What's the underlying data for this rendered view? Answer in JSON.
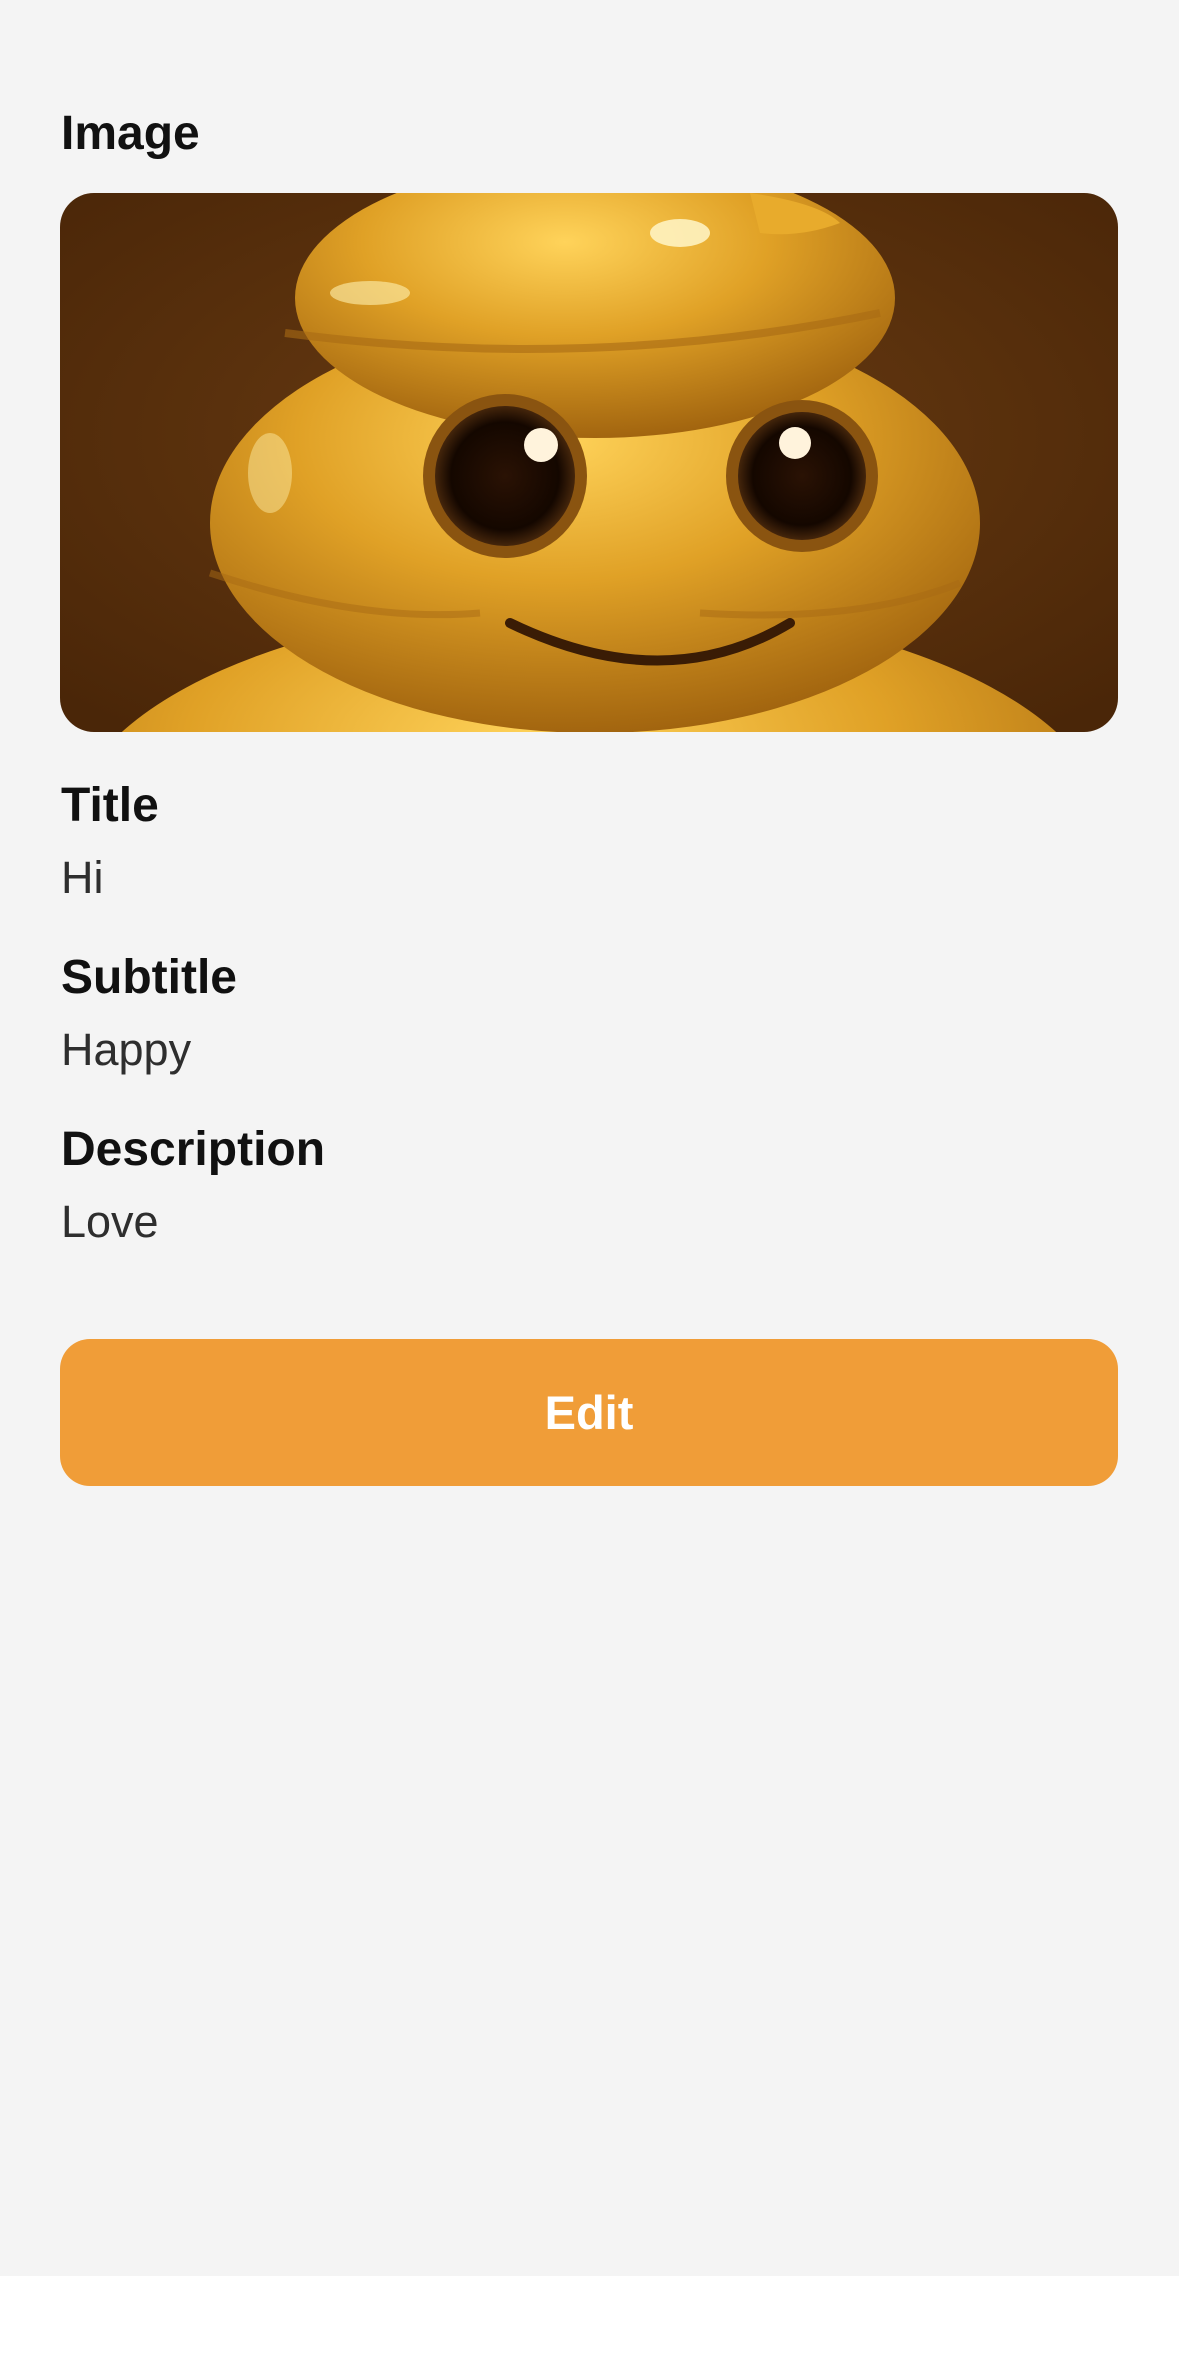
{
  "image_section": {
    "label": "Image",
    "image_subject": "golden-smiling-poop-emoji"
  },
  "title_section": {
    "label": "Title",
    "value": "Hi"
  },
  "subtitle_section": {
    "label": "Subtitle",
    "value": "Happy"
  },
  "description_section": {
    "label": "Description",
    "value": "Love"
  },
  "edit_button": {
    "label": "Edit"
  },
  "colors": {
    "background": "#f4f4f4",
    "accent": "#f09d38",
    "label_text": "#111111",
    "value_text": "#2e2e2e"
  }
}
